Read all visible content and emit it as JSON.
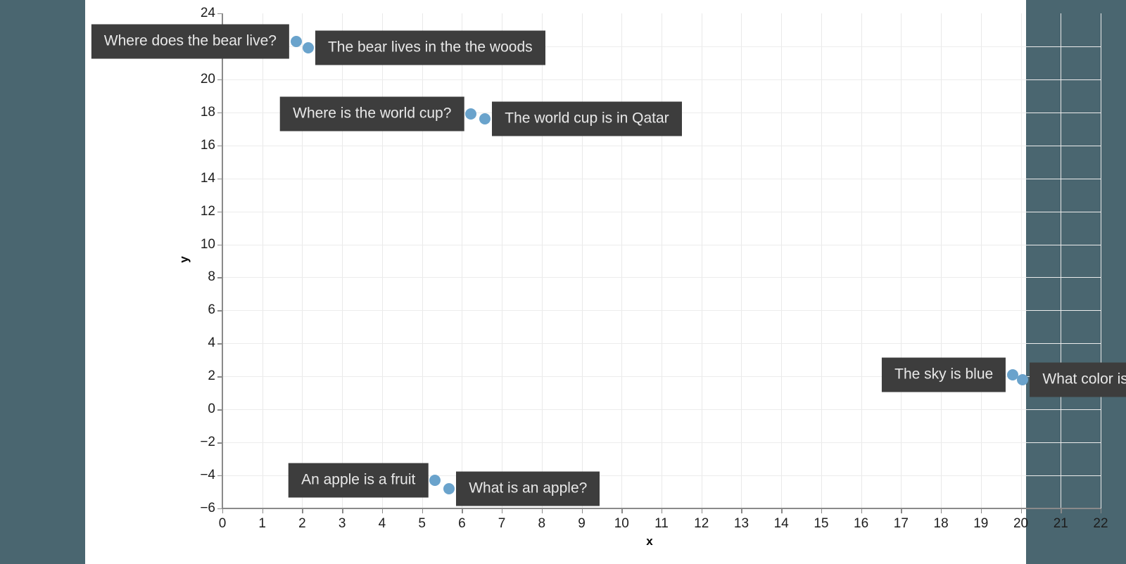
{
  "figure": {
    "background_band_color": "#4a6670",
    "plot_background_color": "#ffffff",
    "point_color": "#6aa3cc",
    "annotation_bg_color": "#3d3d3d",
    "annotation_text_color": "#e8e8e8"
  },
  "chart_data": {
    "type": "scatter",
    "title": "",
    "xlabel": "x",
    "ylabel": "y",
    "xlim": [
      0,
      22
    ],
    "ylim": [
      -6,
      24
    ],
    "xticks": [
      0,
      1,
      2,
      3,
      4,
      5,
      6,
      7,
      8,
      9,
      10,
      11,
      12,
      13,
      14,
      15,
      16,
      17,
      18,
      19,
      20,
      21,
      22
    ],
    "yticks": [
      -6,
      -4,
      -2,
      0,
      2,
      4,
      6,
      8,
      10,
      12,
      14,
      16,
      18,
      20,
      22,
      24
    ],
    "ytick_labels": [
      "−6",
      "−4",
      "−2",
      "0",
      "2",
      "4",
      "6",
      "8",
      "10",
      "12",
      "14",
      "16",
      "18",
      "20",
      "22",
      "24"
    ],
    "grid": true,
    "legend": "none",
    "points": [
      {
        "label": "Where does the bear live?",
        "x": 1.85,
        "y": 22.3,
        "label_side": "left"
      },
      {
        "label": "The bear lives in the the woods",
        "x": 2.15,
        "y": 21.9,
        "label_side": "right"
      },
      {
        "label": "Where is the world cup?",
        "x": 6.23,
        "y": 17.9,
        "label_side": "left"
      },
      {
        "label": "The world cup is in Qatar",
        "x": 6.58,
        "y": 17.6,
        "label_side": "right"
      },
      {
        "label": "The sky is blue",
        "x": 19.8,
        "y": 2.1,
        "label_side": "left"
      },
      {
        "label": "What color is the sky?",
        "x": 20.05,
        "y": 1.8,
        "label_side": "right"
      },
      {
        "label": "An apple is a fruit",
        "x": 5.33,
        "y": -4.3,
        "label_side": "left"
      },
      {
        "label": "What is an apple?",
        "x": 5.68,
        "y": -4.8,
        "label_side": "right"
      }
    ]
  }
}
